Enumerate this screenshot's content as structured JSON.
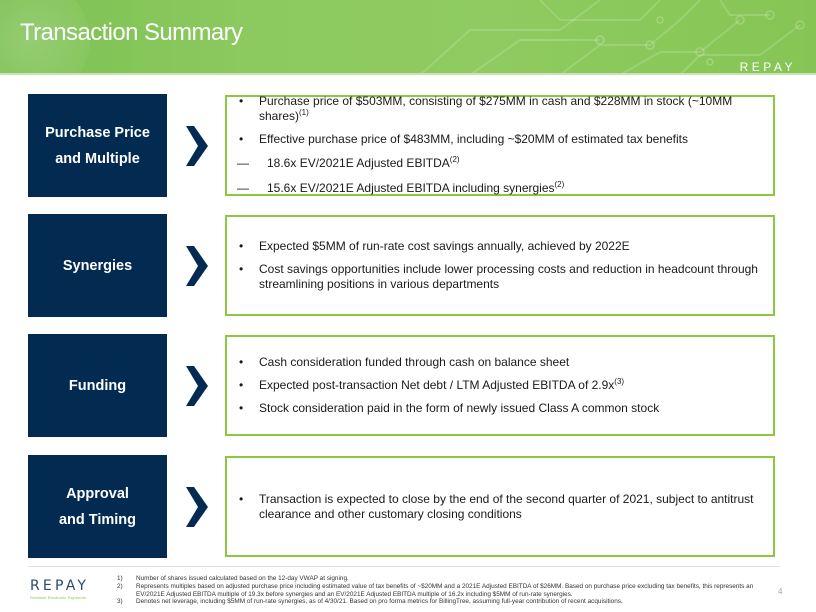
{
  "header": {
    "title": "Transaction Summary",
    "logo_text": "REPAY"
  },
  "colors": {
    "header_green": "#8cc95f",
    "navy": "#032b52",
    "border_green": "#8dc63f"
  },
  "rows": [
    {
      "label_lines": [
        "Purchase Price",
        "and Multiple"
      ],
      "bullets": [
        {
          "text": "Purchase price of $503MM, consisting of $275MM in cash and $228MM in stock (~10MM shares)",
          "sup": "(1)"
        },
        {
          "text": "Effective purchase price of $483MM, including ~$20MM of estimated tax benefits",
          "sup": ""
        }
      ],
      "sub_bullets": [
        {
          "dash": "—",
          "text": "18.6x EV/2021E Adjusted EBITDA",
          "sup": "(2)"
        },
        {
          "dash": "—",
          "text": "15.6x EV/2021E Adjusted EBITDA including synergies",
          "sup": "(2)"
        }
      ]
    },
    {
      "label_lines": [
        "Synergies"
      ],
      "bullets": [
        {
          "text": "Expected $5MM of run-rate cost savings annually, achieved by 2022E",
          "sup": ""
        },
        {
          "text": "Cost savings opportunities include lower processing costs and reduction in headcount through streamlining positions in various departments",
          "sup": ""
        }
      ]
    },
    {
      "label_lines": [
        "Funding"
      ],
      "bullets": [
        {
          "text": "Cash consideration funded through cash on balance sheet",
          "sup": ""
        },
        {
          "text": "Expected post-transaction Net debt / LTM Adjusted EBITDA of 2.9x",
          "sup": "(3)"
        },
        {
          "text": "Stock consideration paid in the form of newly issued Class A common stock",
          "sup": ""
        }
      ]
    },
    {
      "label_lines": [
        "Approval",
        "and Timing"
      ],
      "bullets": [
        {
          "text": "Transaction is expected to close by the end of the second quarter of 2021, subject to antitrust clearance and other customary closing conditions",
          "sup": ""
        }
      ]
    }
  ],
  "footer": {
    "logo_text": "REPAY",
    "logo_tagline": "Realtime Electronic Payments",
    "footnotes": [
      {
        "num": "1)",
        "text": "Number of shares issued calculated based on the 12-day VWAP at signing."
      },
      {
        "num": "2)",
        "text": "Represents multiples based on adjusted purchase price including estimated value of tax benefits of ~$20MM and a 2021E Adjusted EBITDA of $26MM. Based on purchase price excluding tax benefits, this represents an EV/2021E Adjusted EBITDA multiple of 19.3x before synergies and an EV/2021E Adjusted EBITDA multiple of 16.2x including $5MM of run-rate synergies."
      },
      {
        "num": "3)",
        "text": "Denotes net leverage, including $5MM of run-rate synergies, as of 4/30/21. Based on pro forma metrics for BillingTree, assuming full-year contribution of recent acquisitions."
      }
    ],
    "page_number": "4"
  }
}
